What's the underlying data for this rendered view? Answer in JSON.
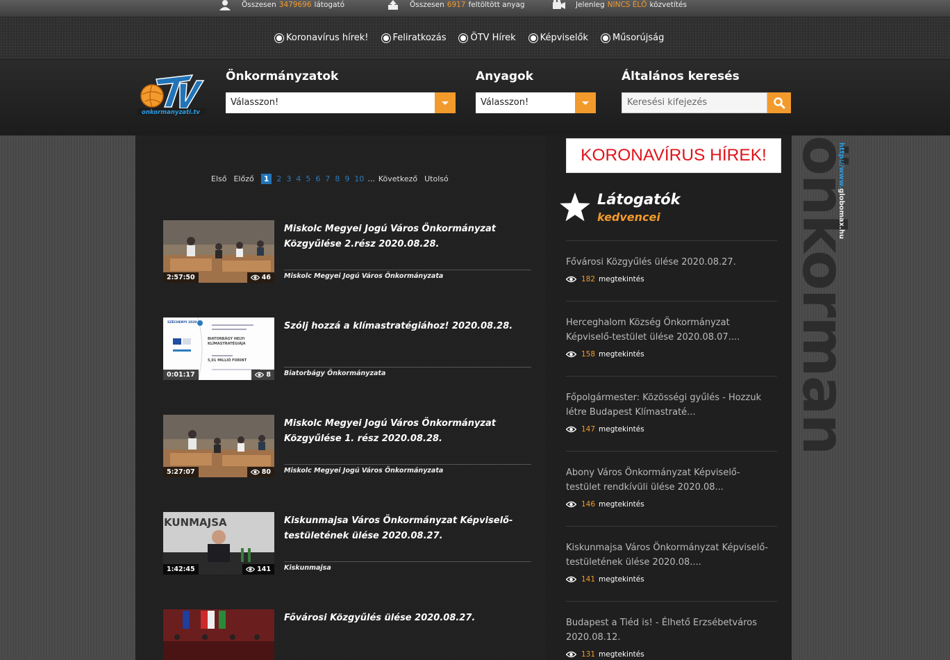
{
  "stats": [
    {
      "prefix": "Összesen",
      "value": "3479696",
      "suffix": "látogató",
      "icon": "visitor-icon"
    },
    {
      "prefix": "Összesen",
      "value": "6917",
      "suffix": "feltöltött anyag",
      "icon": "upload-icon"
    },
    {
      "prefix": "Jelenleg",
      "value": "NINCS ÉLŐ",
      "suffix": "közvetítés",
      "icon": "camera-icon"
    }
  ],
  "nav": [
    "Koronavírus hírek!",
    "Feliratkozás",
    "ÖTV Hírek",
    "Képviselők",
    "Műsorújság"
  ],
  "header": {
    "logo_text": "onkormanyzati.tv",
    "label_onk": "Önkormányzatok",
    "label_anyag": "Anyagok",
    "label_search": "Általános keresés",
    "select_onk": "Válasszon!",
    "select_anyag": "Válasszon!",
    "search_placeholder": "Keresési kifejezés"
  },
  "pager": {
    "first": "Első",
    "prev": "Előző",
    "pages": [
      "1",
      "2",
      "3",
      "4",
      "5",
      "6",
      "7",
      "8",
      "9",
      "10"
    ],
    "current": "1",
    "ellipsis": "...",
    "next": "Következő",
    "last": "Utolsó"
  },
  "videos": [
    {
      "title": "Miskolc Megyei Jogú Város Önkormányzat Közgyűlése 2.rész 2020.08.28.",
      "duration": "2:57:50",
      "views": "46",
      "org": "Miskolc Megyei Jogú Város Önkormányzata"
    },
    {
      "title": "Szólj hozzá a klímastratégiához! 2020.08.28.",
      "duration": "0:01:17",
      "views": "8",
      "org": "Biatorbágy Önkormányzata"
    },
    {
      "title": "Miskolc Megyei Jogú Város Önkormányzat Közgyűlése 1. rész 2020.08.28.",
      "duration": "5:27:07",
      "views": "80",
      "org": "Miskolc Megyei Jogú Város Önkormányzata"
    },
    {
      "title": "Kiskunmajsa Város Önkormányzat Képviselő-testületének ülése 2020.08.27.",
      "duration": "1:42:45",
      "views": "141",
      "org": "Kiskunmajsa"
    },
    {
      "title": "Fővárosi Közgyűlés ülése 2020.08.27.",
      "duration": "",
      "views": "",
      "org": ""
    }
  ],
  "thumb_text": {
    "biator_header": "SZÉCHENYI 2020",
    "biator_title": "BIATORBÁGY HELYI KLÍMASTRATÉGIÁJA",
    "biator_amount": "5,01 MILLIÓ FORINT",
    "kiskun_word": "KUNMAJSA"
  },
  "sidebar": {
    "banner": "KORONAVÍRUS HÍREK!",
    "fav_title": "Látogatók",
    "fav_sub": "kedvencei",
    "views_label": "megtekintés",
    "items": [
      {
        "title": "Fővárosi Közgyűlés ülése 2020.08.27.",
        "views": "182"
      },
      {
        "title": "Herceghalom Község Önkormányzat Képviselő-testület ülése 2020.08.07....",
        "views": "158"
      },
      {
        "title": "Főpolgármester: Közösségi gyűlés - Hozzuk létre Budapest Klímastraté...",
        "views": "147"
      },
      {
        "title": "Abony Város Önkormányzat Képviselő-testület rendkívüli ülése 2020.08...",
        "views": "146"
      },
      {
        "title": "Kiskunmajsa Város Önkormányzat Képviselő-testületének ülése 2020.08....",
        "views": "141"
      },
      {
        "title": "Budapest a Tiéd is! - Élhető Erzsébetváros 2020.08.12.",
        "views": "131"
      }
    ]
  },
  "deco": {
    "big": "önkorman",
    "url_a": "http://www.",
    "url_b": "globomax.hu"
  },
  "colors": {
    "accent": "#f39a2c",
    "link": "#2b7bbd",
    "banner_red": "#e0141b"
  }
}
